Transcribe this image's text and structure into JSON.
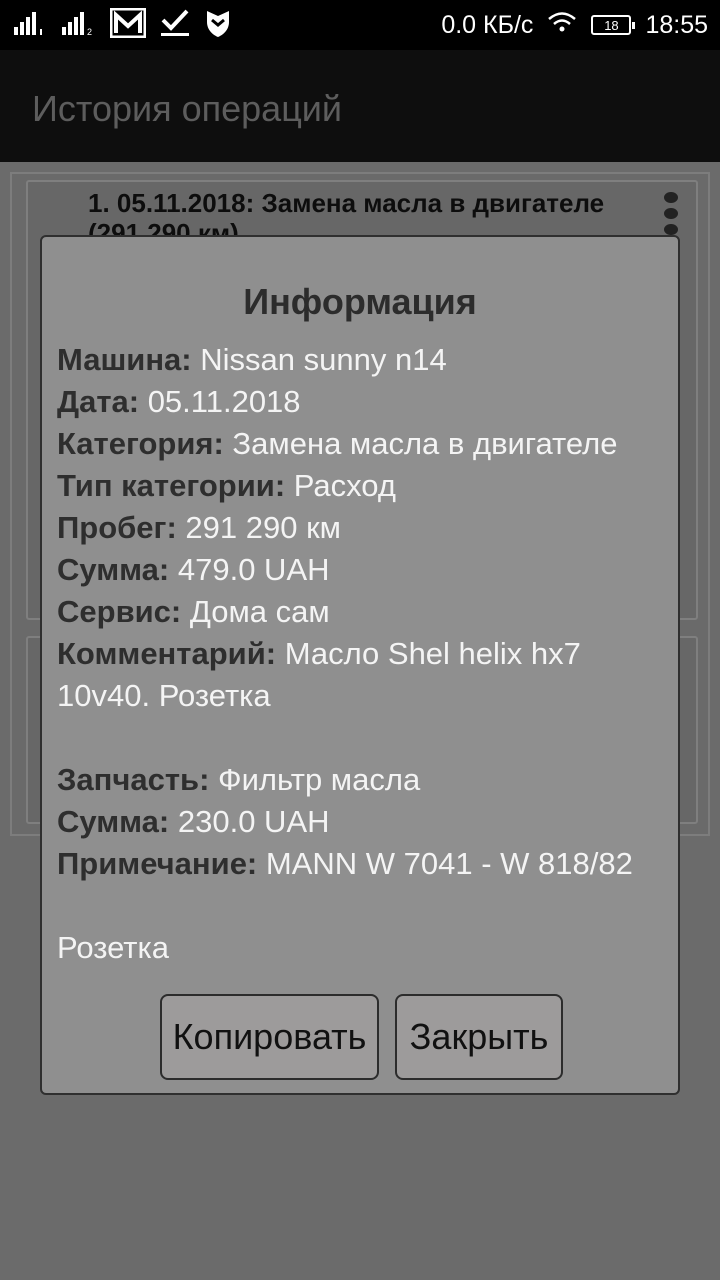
{
  "status_bar": {
    "speed": "0.0 КБ/с",
    "battery": "18",
    "time": "18:55",
    "icons": [
      "signal-1-icon",
      "signal-2-icon",
      "gmail-icon",
      "check-icon",
      "shield-icon",
      "wifi-icon",
      "battery-icon"
    ]
  },
  "app_bar": {
    "title": "История операций"
  },
  "list": {
    "item1": "1. 05.11.2018: Замена масла в двигателе (291 290 км)"
  },
  "dialog": {
    "title": "Информация",
    "rows": [
      {
        "label": "Машина:",
        "value": " Nissan sunny n14"
      },
      {
        "label": "Дата:",
        "value": " 05.11.2018"
      },
      {
        "label": "Категория:",
        "value": " Замена масла в двигателе"
      },
      {
        "label": "Тип категории:",
        "value": " Расход"
      },
      {
        "label": "Пробег:",
        "value": " 291 290 км"
      },
      {
        "label": "Сумма:",
        "value": " 479.0 UAH"
      },
      {
        "label": "Сервис:",
        "value": " Дома сам"
      },
      {
        "label": "Комментарий:",
        "value": " Масло Shel helix hx7 10v40. Розетка"
      }
    ],
    "part": [
      {
        "label": "Запчасть:",
        "value": " Фильтр масла"
      },
      {
        "label": "Сумма:",
        "value": " 230.0 UAH"
      },
      {
        "label": "Примечание:",
        "value": " MANN W 7041 - W 818/82"
      }
    ],
    "footer_note": "Розетка",
    "copy_button": "Копировать",
    "close_button": "Закрыть"
  }
}
